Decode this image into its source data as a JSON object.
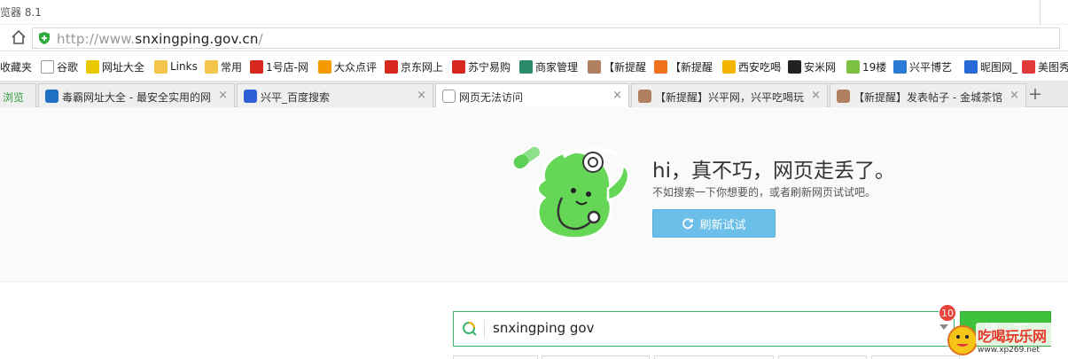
{
  "window": {
    "title": "览器 8.1"
  },
  "address": {
    "url_prefix": "http://www.",
    "url_main": "snxingping.gov.cn",
    "url_suffix": "/"
  },
  "bookmarks": [
    {
      "label": "收藏夹",
      "icon": "star-icon",
      "color": "#f5b400"
    },
    {
      "label": "谷歌",
      "icon": "page-icon",
      "color": "#ffffff"
    },
    {
      "label": "网址大全",
      "icon": "plus-circle-icon",
      "color": "#e8c800"
    },
    {
      "label": "Links",
      "icon": "folder-icon",
      "color": "#f3c64b"
    },
    {
      "label": "常用",
      "icon": "folder-icon",
      "color": "#f3c64b"
    },
    {
      "label": "1号店-网",
      "icon": "yhd-icon",
      "color": "#d6281e"
    },
    {
      "label": "大众点评",
      "icon": "dianping-icon",
      "color": "#f59a00"
    },
    {
      "label": "京东网上",
      "icon": "jd-icon",
      "color": "#d6281e"
    },
    {
      "label": "苏宁易购",
      "icon": "suning-icon",
      "color": "#d6281e"
    },
    {
      "label": "商家管理",
      "icon": "qrcode-icon",
      "color": "#2a8a6a"
    },
    {
      "label": "【新提醒",
      "icon": "avatar-icon",
      "color": "#b08060"
    },
    {
      "label": "【新提醒",
      "icon": "orange-badge-icon",
      "color": "#f07020"
    },
    {
      "label": "西安吃喝",
      "icon": "cup-icon",
      "color": "#f5b400"
    },
    {
      "label": "安米网",
      "icon": "anmi-icon",
      "color": "#222222"
    },
    {
      "label": "19楼",
      "icon": "nineteen-icon",
      "color": "#7cc142"
    },
    {
      "label": "兴平博艺",
      "icon": "shield-icon",
      "color": "#2a7ad6"
    },
    {
      "label": "昵图网_",
      "icon": "nipic-icon",
      "color": "#2a6ad6"
    },
    {
      "label": "美图秀",
      "icon": "meitu-icon",
      "color": "#e23a3a"
    }
  ],
  "tabs": [
    {
      "label": "浏览",
      "icon": "",
      "color": "#3cb371"
    },
    {
      "label": "毒霸网址大全 - 最安全实用的网",
      "icon": "duba-icon",
      "color": "#1f6fc4"
    },
    {
      "label": "兴平_百度搜索",
      "icon": "baidu-paw-icon",
      "color": "#2f5fd6"
    },
    {
      "label": "网页无法访问",
      "icon": "page-icon",
      "color": "#ffffff"
    },
    {
      "label": "【新提醒】兴平网，兴平吃喝玩",
      "icon": "avatar-icon",
      "color": "#b08060"
    },
    {
      "label": "【新提醒】发表帖子 - 金城茶馆",
      "icon": "avatar-icon",
      "color": "#b08060"
    }
  ],
  "error": {
    "title": "hi，真不巧，网页走丢了。",
    "subtitle": "不如搜索一下你想要的，或者刷新网页试试吧。",
    "refresh_label": "刷新试试"
  },
  "search": {
    "value": "snxingping gov",
    "button_label": "搜一下",
    "badge_count": "10"
  },
  "watermark": {
    "text": "吃喝玩乐网",
    "url": "www.xp269.net"
  },
  "colors": {
    "accent_green": "#3ec23e",
    "refresh_blue": "#6cbfe8",
    "badge_red": "#e8433a"
  }
}
